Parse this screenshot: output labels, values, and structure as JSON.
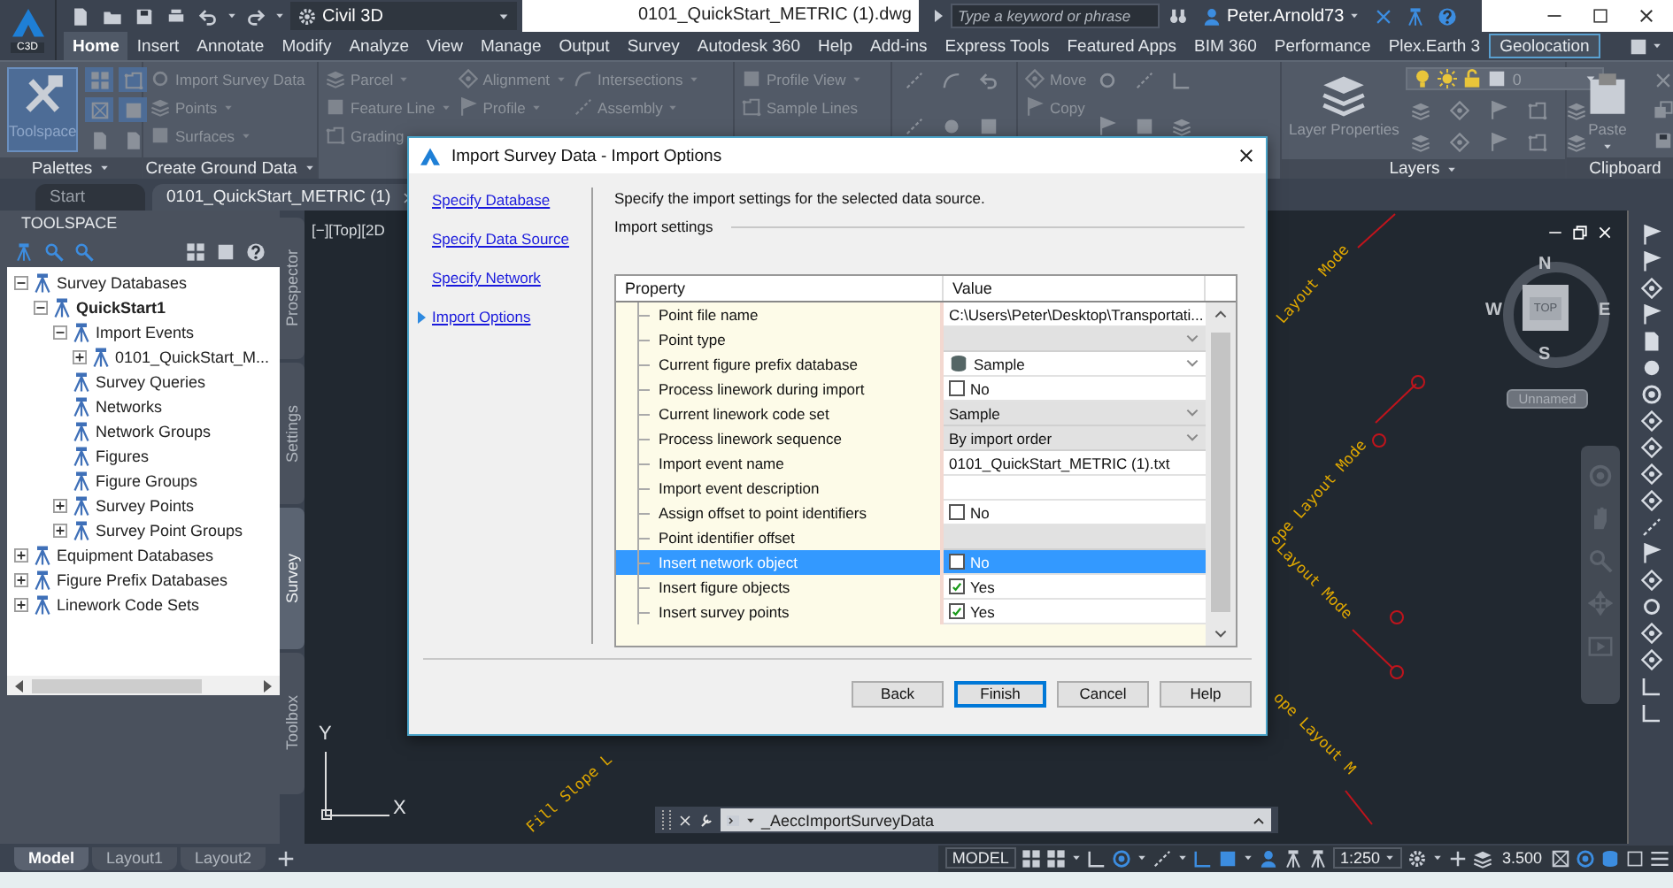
{
  "app_menu": {
    "label": "C3D"
  },
  "quick_access": {
    "workspace": "Civil 3D"
  },
  "document_title": "0101_QuickStart_METRIC (1).dwg",
  "search": {
    "placeholder": "Type a keyword or phrase"
  },
  "user": {
    "name": "Peter.Arnold73"
  },
  "ribbon_tabs": [
    {
      "label": "Home",
      "selected": true,
      "outlined": false
    },
    {
      "label": "Insert",
      "selected": false,
      "outlined": false
    },
    {
      "label": "Annotate",
      "selected": false,
      "outlined": false
    },
    {
      "label": "Modify",
      "selected": false,
      "outlined": false
    },
    {
      "label": "Analyze",
      "selected": false,
      "outlined": false
    },
    {
      "label": "View",
      "selected": false,
      "outlined": false
    },
    {
      "label": "Manage",
      "selected": false,
      "outlined": false
    },
    {
      "label": "Output",
      "selected": false,
      "outlined": false
    },
    {
      "label": "Survey",
      "selected": false,
      "outlined": false
    },
    {
      "label": "Autodesk 360",
      "selected": false,
      "outlined": false
    },
    {
      "label": "Help",
      "selected": false,
      "outlined": false
    },
    {
      "label": "Add-ins",
      "selected": false,
      "outlined": false
    },
    {
      "label": "Express Tools",
      "selected": false,
      "outlined": false
    },
    {
      "label": "Featured Apps",
      "selected": false,
      "outlined": false
    },
    {
      "label": "BIM 360",
      "selected": false,
      "outlined": false
    },
    {
      "label": "Performance",
      "selected": false,
      "outlined": false
    },
    {
      "label": "Plex.Earth 3",
      "selected": false,
      "outlined": false
    },
    {
      "label": "Geolocation",
      "selected": false,
      "outlined": true
    }
  ],
  "ribbon_panels": [
    {
      "kind": "palettes",
      "title": "Palettes",
      "menu": true,
      "large_button": "Toolspace"
    },
    {
      "kind": "commands",
      "title": "Create Ground Data",
      "menu": true,
      "columns": [
        [
          {
            "label": "Import Survey Data",
            "dropdown": false
          },
          {
            "label": "Points",
            "dropdown": true
          },
          {
            "label": "Surfaces",
            "dropdown": true
          }
        ]
      ]
    },
    {
      "kind": "commands",
      "columns": [
        [
          {
            "label": "Parcel",
            "dropdown": true
          },
          {
            "label": "Feature Line",
            "dropdown": true
          },
          {
            "label": "Grading",
            "dropdown": false
          }
        ],
        [
          {
            "label": "Alignment",
            "dropdown": true
          },
          {
            "label": "Profile",
            "dropdown": true
          }
        ],
        [
          {
            "label": "Intersections",
            "dropdown": true
          },
          {
            "label": "Assembly",
            "dropdown": true
          }
        ]
      ]
    },
    {
      "kind": "commands",
      "columns": [
        [
          {
            "label": "Profile View",
            "dropdown": true
          },
          {
            "label": "Sample Lines",
            "dropdown": false
          }
        ]
      ]
    },
    {
      "kind": "draw"
    },
    {
      "kind": "commands",
      "columns": [
        [
          {
            "label": "Move",
            "dropdown": false
          },
          {
            "label": "Copy",
            "dropdown": false
          }
        ]
      ]
    },
    {
      "kind": "layers",
      "title": "Layers",
      "menu": true,
      "large_button": "Layer Properties",
      "layer": "0"
    },
    {
      "kind": "clipboard",
      "title": "Clipboard",
      "menu": false,
      "large_button": "Paste"
    }
  ],
  "file_tabs": [
    {
      "label": "Start",
      "selected": false
    },
    {
      "label": "0101_QuickStart_METRIC (1)",
      "selected": true
    }
  ],
  "toolspace": {
    "title": "TOOLSPACE",
    "tree": [
      {
        "label": "Survey Databases",
        "expanded": true,
        "children": [
          {
            "label": "QuickStart1",
            "expanded": true,
            "current": true,
            "children": [
              {
                "label": "Import Events",
                "expanded": true,
                "children": [
                  {
                    "label": "0101_QuickStart_M...",
                    "expanded": false
                  }
                ]
              },
              {
                "label": "Survey Queries"
              },
              {
                "label": "Networks"
              },
              {
                "label": "Network Groups"
              },
              {
                "label": "Figures"
              },
              {
                "label": "Figure Groups"
              },
              {
                "label": "Survey Points",
                "expanded": false
              },
              {
                "label": "Survey Point Groups",
                "expanded": false
              }
            ]
          }
        ]
      },
      {
        "label": "Equipment Databases",
        "expanded": false
      },
      {
        "label": "Figure Prefix Databases",
        "expanded": false
      },
      {
        "label": "Linework Code Sets",
        "expanded": false
      }
    ],
    "side_tabs": [
      {
        "label": "Prospector",
        "selected": false
      },
      {
        "label": "Settings",
        "selected": false
      },
      {
        "label": "Survey",
        "selected": true
      },
      {
        "label": "Toolbox",
        "selected": false
      }
    ]
  },
  "viewport": {
    "view_label": "[−][Top][2D",
    "viewcube": {
      "north": "N",
      "south": "S",
      "east": "E",
      "west": "W",
      "face": "TOP",
      "coordinate_system": "Unnamed"
    },
    "drawing_labels": [
      {
        "text": "Layout Mode"
      },
      {
        "text": "ope Layout Mode"
      },
      {
        "text": "Layout Mode"
      },
      {
        "text": "ope Layout M"
      },
      {
        "text": "Fill Slope L"
      }
    ],
    "ucs": {
      "x_label": "X",
      "y_label": "Y"
    }
  },
  "command_line": {
    "text": "_AeccImportSurveyData"
  },
  "layout_tabs": [
    {
      "label": "Model",
      "selected": true
    },
    {
      "label": "Layout1",
      "selected": false
    },
    {
      "label": "Layout2",
      "selected": false
    }
  ],
  "status_bar": {
    "space": "MODEL",
    "annotation_scale": "1:250",
    "readout": "3.500"
  },
  "dialog": {
    "title": "Import Survey Data - Import Options",
    "steps": [
      {
        "label": "Specify Database",
        "selected": false
      },
      {
        "label": "Specify Data Source",
        "selected": false
      },
      {
        "label": "Specify Network",
        "selected": false
      },
      {
        "label": "Import Options",
        "selected": true
      }
    ],
    "instruction": "Specify the import settings for the selected data source.",
    "group_label": "Import settings",
    "columns": [
      "Property",
      "Value"
    ],
    "rows": [
      {
        "property": "Point file name",
        "kind": "text",
        "value": "C:\\Users\\Peter\\Desktop\\Transportati...",
        "disabled": false,
        "selected": false
      },
      {
        "property": "Point type",
        "kind": "dropdown",
        "disabled": true,
        "selected": false
      },
      {
        "property": "Current figure prefix database",
        "kind": "icon-dropdown",
        "value": "Sample",
        "disabled": false,
        "selected": false
      },
      {
        "property": "Process linework during import",
        "kind": "checkbox",
        "value": "No",
        "checked": false,
        "disabled": false,
        "selected": false
      },
      {
        "property": "Current linework code set",
        "kind": "dropdown",
        "value": "Sample",
        "disabled": true,
        "selected": false
      },
      {
        "property": "Process linework sequence",
        "kind": "dropdown",
        "value": "By import order",
        "disabled": true,
        "selected": false
      },
      {
        "property": "Import event name",
        "kind": "text",
        "value": "0101_QuickStart_METRIC (1).txt",
        "disabled": false,
        "selected": false
      },
      {
        "property": "Import event description",
        "kind": "text",
        "disabled": false,
        "selected": false
      },
      {
        "property": "Assign offset to point identifiers",
        "kind": "checkbox",
        "value": "No",
        "checked": false,
        "disabled": false,
        "selected": false
      },
      {
        "property": "Point identifier offset",
        "kind": "text",
        "disabled": true,
        "selected": false
      },
      {
        "property": "Insert network object",
        "kind": "checkbox",
        "value": "No",
        "checked": false,
        "disabled": false,
        "selected": true
      },
      {
        "property": "Insert figure objects",
        "kind": "checkbox",
        "value": "Yes",
        "checked": true,
        "disabled": false,
        "selected": false
      },
      {
        "property": "Insert survey points",
        "kind": "checkbox",
        "value": "Yes",
        "checked": true,
        "disabled": false,
        "selected": false
      }
    ],
    "buttons": [
      {
        "label": "Back",
        "default": false
      },
      {
        "label": "Finish",
        "default": true
      },
      {
        "label": "Cancel",
        "default": false
      },
      {
        "label": "Help",
        "default": false
      }
    ]
  }
}
